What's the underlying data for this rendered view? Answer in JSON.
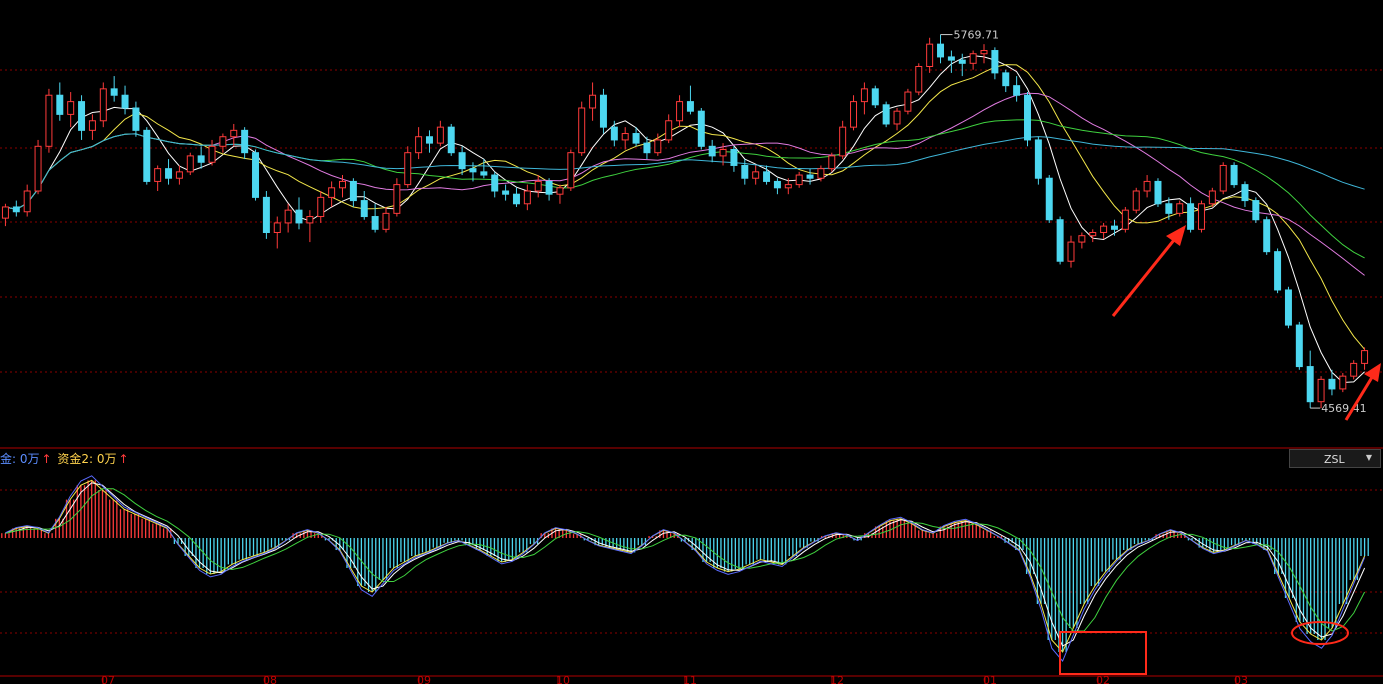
{
  "indicator_bar": {
    "fund1_label": "金: 0万",
    "fund1_color": "#5b8dff",
    "fund2_label": "资金2: 0万",
    "fund2_color": "#ffd34d",
    "arrow_color": "#ff3b3b"
  },
  "indicator_select": {
    "value": "ZSL"
  },
  "colors": {
    "up": "#ff3b3b",
    "down": "#4dd7f0",
    "ma5": "#ffffff",
    "ma10": "#f2e64a",
    "ma20": "#e07be0",
    "ma30": "#3fd13f",
    "ma60": "#3fb6d8",
    "grid": "#8a0000",
    "annotation": "#ff2a1a"
  },
  "chart_data": [
    {
      "type": "candlestick",
      "panel": "price",
      "title": "",
      "high_label": "5769.71",
      "low_label": "4569.41",
      "ylim": [
        4500,
        5800
      ],
      "series": [
        {
          "values": [
            [
              5195,
              5240,
              5170,
              5230
            ],
            [
              5230,
              5250,
              5200,
              5215
            ],
            [
              5215,
              5300,
              5200,
              5280
            ],
            [
              5280,
              5440,
              5270,
              5420
            ],
            [
              5420,
              5600,
              5400,
              5580
            ],
            [
              5580,
              5620,
              5500,
              5520
            ],
            [
              5520,
              5590,
              5480,
              5560
            ],
            [
              5560,
              5580,
              5440,
              5470
            ],
            [
              5470,
              5520,
              5440,
              5500
            ],
            [
              5500,
              5620,
              5480,
              5600
            ],
            [
              5600,
              5640,
              5560,
              5580
            ],
            [
              5580,
              5610,
              5520,
              5540
            ],
            [
              5540,
              5560,
              5450,
              5470
            ],
            [
              5470,
              5480,
              5300,
              5310
            ],
            [
              5310,
              5360,
              5280,
              5350
            ],
            [
              5350,
              5380,
              5300,
              5320
            ],
            [
              5320,
              5360,
              5300,
              5340
            ],
            [
              5340,
              5400,
              5330,
              5390
            ],
            [
              5390,
              5420,
              5350,
              5370
            ],
            [
              5370,
              5440,
              5360,
              5420
            ],
            [
              5420,
              5460,
              5400,
              5450
            ],
            [
              5450,
              5490,
              5420,
              5470
            ],
            [
              5470,
              5480,
              5380,
              5400
            ],
            [
              5400,
              5410,
              5250,
              5260
            ],
            [
              5260,
              5280,
              5130,
              5150
            ],
            [
              5150,
              5200,
              5100,
              5180
            ],
            [
              5180,
              5240,
              5150,
              5220
            ],
            [
              5220,
              5260,
              5160,
              5180
            ],
            [
              5180,
              5220,
              5120,
              5200
            ],
            [
              5200,
              5280,
              5180,
              5260
            ],
            [
              5260,
              5310,
              5230,
              5290
            ],
            [
              5290,
              5330,
              5260,
              5310
            ],
            [
              5310,
              5320,
              5230,
              5250
            ],
            [
              5250,
              5280,
              5190,
              5200
            ],
            [
              5200,
              5240,
              5150,
              5160
            ],
            [
              5160,
              5230,
              5150,
              5210
            ],
            [
              5210,
              5320,
              5200,
              5300
            ],
            [
              5300,
              5420,
              5290,
              5400
            ],
            [
              5400,
              5480,
              5380,
              5450
            ],
            [
              5450,
              5470,
              5400,
              5430
            ],
            [
              5430,
              5500,
              5420,
              5480
            ],
            [
              5480,
              5490,
              5390,
              5400
            ],
            [
              5400,
              5420,
              5330,
              5350
            ],
            [
              5350,
              5370,
              5310,
              5340
            ],
            [
              5340,
              5380,
              5320,
              5330
            ],
            [
              5330,
              5340,
              5260,
              5280
            ],
            [
              5280,
              5300,
              5250,
              5270
            ],
            [
              5270,
              5290,
              5230,
              5240
            ],
            [
              5240,
              5300,
              5220,
              5280
            ],
            [
              5280,
              5330,
              5260,
              5310
            ],
            [
              5310,
              5320,
              5250,
              5270
            ],
            [
              5270,
              5300,
              5240,
              5290
            ],
            [
              5290,
              5410,
              5280,
              5400
            ],
            [
              5400,
              5560,
              5390,
              5540
            ],
            [
              5540,
              5620,
              5500,
              5580
            ],
            [
              5580,
              5600,
              5460,
              5480
            ],
            [
              5480,
              5500,
              5420,
              5440
            ],
            [
              5440,
              5480,
              5410,
              5460
            ],
            [
              5460,
              5480,
              5420,
              5430
            ],
            [
              5430,
              5450,
              5380,
              5400
            ],
            [
              5400,
              5460,
              5390,
              5440
            ],
            [
              5440,
              5520,
              5430,
              5500
            ],
            [
              5500,
              5580,
              5480,
              5560
            ],
            [
              5560,
              5610,
              5520,
              5530
            ],
            [
              5530,
              5540,
              5410,
              5420
            ],
            [
              5420,
              5440,
              5370,
              5390
            ],
            [
              5390,
              5430,
              5360,
              5410
            ],
            [
              5410,
              5420,
              5340,
              5360
            ],
            [
              5360,
              5380,
              5300,
              5320
            ],
            [
              5320,
              5360,
              5300,
              5340
            ],
            [
              5340,
              5360,
              5300,
              5310
            ],
            [
              5310,
              5320,
              5270,
              5290
            ],
            [
              5290,
              5320,
              5270,
              5300
            ],
            [
              5300,
              5340,
              5290,
              5330
            ],
            [
              5330,
              5350,
              5300,
              5320
            ],
            [
              5320,
              5360,
              5310,
              5350
            ],
            [
              5350,
              5400,
              5340,
              5390
            ],
            [
              5390,
              5500,
              5380,
              5480
            ],
            [
              5480,
              5580,
              5470,
              5560
            ],
            [
              5560,
              5620,
              5520,
              5600
            ],
            [
              5600,
              5610,
              5540,
              5550
            ],
            [
              5550,
              5560,
              5480,
              5490
            ],
            [
              5490,
              5540,
              5470,
              5530
            ],
            [
              5530,
              5600,
              5520,
              5590
            ],
            [
              5590,
              5680,
              5580,
              5670
            ],
            [
              5670,
              5760,
              5650,
              5740
            ],
            [
              5740,
              5770,
              5680,
              5700
            ],
            [
              5700,
              5720,
              5650,
              5690
            ],
            [
              5690,
              5710,
              5640,
              5680
            ],
            [
              5680,
              5720,
              5660,
              5710
            ],
            [
              5710,
              5740,
              5680,
              5720
            ],
            [
              5720,
              5730,
              5630,
              5650
            ],
            [
              5650,
              5660,
              5590,
              5610
            ],
            [
              5610,
              5640,
              5560,
              5580
            ],
            [
              5580,
              5590,
              5420,
              5440
            ],
            [
              5440,
              5450,
              5300,
              5320
            ],
            [
              5320,
              5330,
              5180,
              5190
            ],
            [
              5190,
              5200,
              5050,
              5060
            ],
            [
              5060,
              5140,
              5040,
              5120
            ],
            [
              5120,
              5150,
              5100,
              5140
            ],
            [
              5140,
              5160,
              5120,
              5150
            ],
            [
              5150,
              5180,
              5130,
              5170
            ],
            [
              5170,
              5190,
              5140,
              5160
            ],
            [
              5160,
              5230,
              5150,
              5220
            ],
            [
              5220,
              5290,
              5210,
              5280
            ],
            [
              5280,
              5330,
              5260,
              5310
            ],
            [
              5310,
              5320,
              5230,
              5240
            ],
            [
              5240,
              5260,
              5190,
              5210
            ],
            [
              5210,
              5250,
              5200,
              5240
            ],
            [
              5240,
              5260,
              5150,
              5160
            ],
            [
              5160,
              5250,
              5150,
              5240
            ],
            [
              5240,
              5290,
              5230,
              5280
            ],
            [
              5280,
              5370,
              5270,
              5360
            ],
            [
              5360,
              5370,
              5290,
              5300
            ],
            [
              5300,
              5310,
              5230,
              5250
            ],
            [
              5250,
              5260,
              5180,
              5190
            ],
            [
              5190,
              5200,
              5080,
              5090
            ],
            [
              5090,
              5100,
              4960,
              4970
            ],
            [
              4970,
              4980,
              4850,
              4860
            ],
            [
              4860,
              4870,
              4720,
              4730
            ],
            [
              4730,
              4780,
              4600,
              4620
            ],
            [
              4620,
              4700,
              4600,
              4690
            ],
            [
              4690,
              4720,
              4640,
              4660
            ],
            [
              4660,
              4710,
              4650,
              4700
            ],
            [
              4700,
              4750,
              4690,
              4740
            ],
            [
              4740,
              4790,
              4720,
              4780
            ]
          ]
        }
      ]
    },
    {
      "type": "bar",
      "panel": "indicator",
      "title": "ZSL",
      "ylim": [
        -1,
        1
      ],
      "series": [
        {
          "values": [
            0.05,
            0.1,
            0.12,
            0.1,
            0.05,
            0.2,
            0.4,
            0.55,
            0.6,
            0.5,
            0.4,
            0.3,
            0.25,
            0.2,
            0.15,
            0.1,
            -0.05,
            -0.15,
            -0.25,
            -0.3,
            -0.28,
            -0.22,
            -0.18,
            -0.15,
            -0.12,
            -0.08,
            -0.02,
            0.05,
            0.08,
            0.05,
            -0.02,
            -0.1,
            -0.25,
            -0.4,
            -0.45,
            -0.35,
            -0.25,
            -0.2,
            -0.15,
            -0.12,
            -0.08,
            -0.04,
            -0.02,
            -0.06,
            -0.1,
            -0.15,
            -0.2,
            -0.18,
            -0.12,
            -0.05,
            0.05,
            0.1,
            0.08,
            0.04,
            -0.02,
            -0.06,
            -0.08,
            -0.1,
            -0.12,
            -0.06,
            0.02,
            0.08,
            0.05,
            -0.03,
            -0.1,
            -0.2,
            -0.25,
            -0.28,
            -0.26,
            -0.22,
            -0.18,
            -0.2,
            -0.22,
            -0.15,
            -0.08,
            -0.03,
            0.02,
            0.05,
            0.03,
            -0.02,
            0.05,
            0.12,
            0.18,
            0.2,
            0.15,
            0.08,
            0.05,
            0.12,
            0.16,
            0.18,
            0.14,
            0.08,
            0.02,
            -0.04,
            -0.1,
            -0.3,
            -0.55,
            -0.85,
            -0.95,
            -0.75,
            -0.55,
            -0.4,
            -0.28,
            -0.18,
            -0.1,
            -0.05,
            -0.02,
            0.04,
            0.08,
            0.05,
            -0.02,
            -0.08,
            -0.12,
            -0.1,
            -0.06,
            -0.02,
            -0.05,
            -0.1,
            -0.3,
            -0.5,
            -0.7,
            -0.8,
            -0.85,
            -0.75,
            -0.55,
            -0.35,
            -0.15
          ]
        }
      ]
    }
  ],
  "x_ticks": [
    "07",
    "08",
    "09",
    "10",
    "11",
    "12",
    "01",
    "02",
    "03"
  ]
}
